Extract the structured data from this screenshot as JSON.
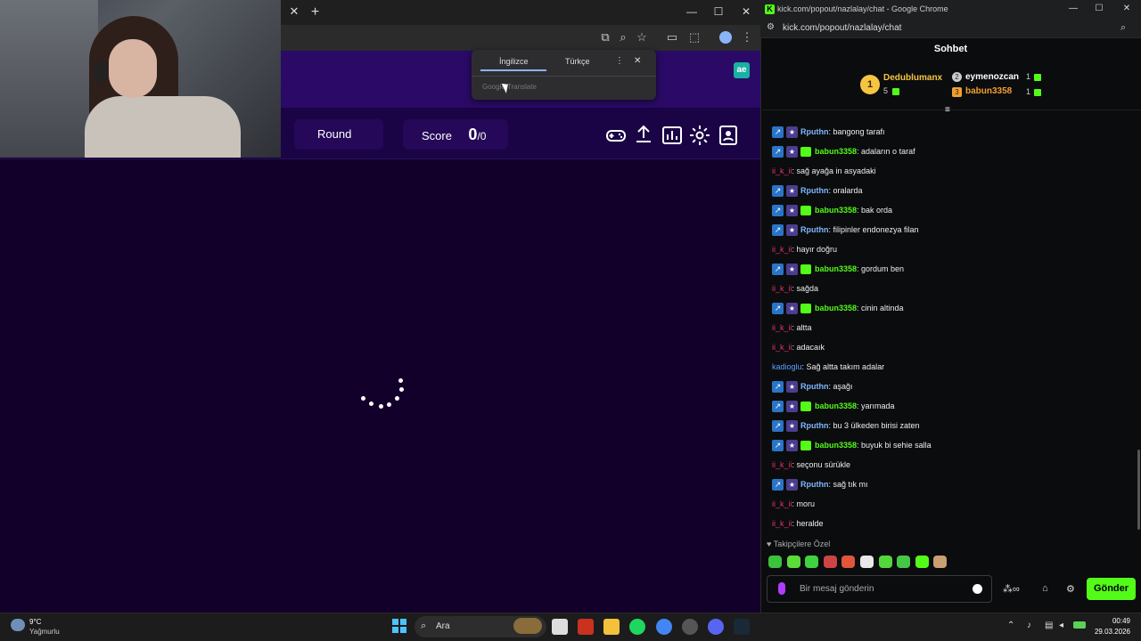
{
  "left_browser": {
    "game": {
      "round_label": "Round",
      "score_label": "Score",
      "score_value": "0",
      "score_total": "/0",
      "brand_badge": "ae"
    },
    "translate_popup": {
      "tab_source": "İngilizce",
      "tab_target": "Türkçe",
      "logo": "Google Translate"
    }
  },
  "chat_window": {
    "title_bar": "kick.com/popout/nazlalay/chat - Google Chrome",
    "url": "kick.com/popout/nazlalay/chat",
    "header": "Sohbet",
    "top_gifters": [
      {
        "name": "Dedublumanx",
        "count": "5",
        "color": "#f5c542"
      },
      {
        "name": "eymenozcan",
        "count": "1",
        "color": "#ffffff"
      },
      {
        "name": "babun3358",
        "count": "1",
        "color": "#f0a030"
      }
    ],
    "messages": [
      {
        "user": "Rputhn",
        "text": ": bangong tarafı",
        "style": "blue",
        "badges": 2
      },
      {
        "user": "babun3358",
        "text": ": adaların o taraf",
        "style": "green",
        "badges": 3
      },
      {
        "user": "ii_k_ii",
        "text": ": sağ ayağa in asyadaki",
        "style": "red",
        "badges": 0
      },
      {
        "user": "Rputhn",
        "text": ": oralarda",
        "style": "blue",
        "badges": 2
      },
      {
        "user": "babun3358",
        "text": ": bak orda",
        "style": "green",
        "badges": 3
      },
      {
        "user": "Rputhn",
        "text": ": filipinler endonezya filan",
        "style": "blue",
        "badges": 2
      },
      {
        "user": "ii_k_ii",
        "text": ": hayır doğru",
        "style": "red",
        "badges": 0
      },
      {
        "user": "babun3358",
        "text": ": gordum ben",
        "style": "green",
        "badges": 3
      },
      {
        "user": "ii_k_ii",
        "text": ": sağda",
        "style": "red",
        "badges": 0
      },
      {
        "user": "babun3358",
        "text": ": cinin altinda",
        "style": "green",
        "badges": 3
      },
      {
        "user": "ii_k_ii",
        "text": ": altta",
        "style": "red",
        "badges": 0
      },
      {
        "user": "ii_k_ii",
        "text": ": adacaık",
        "style": "red",
        "badges": 0
      },
      {
        "user": "kadioglu",
        "text": ": Sağ altta takım adalar",
        "style": "kadi",
        "badges": 0
      },
      {
        "user": "Rputhn",
        "text": ": aşağı",
        "style": "blue",
        "badges": 2
      },
      {
        "user": "babun3358",
        "text": ": yarımada",
        "style": "green",
        "badges": 3
      },
      {
        "user": "Rputhn",
        "text": ": bu 3 ülkeden birisi zaten",
        "style": "blue",
        "badges": 2
      },
      {
        "user": "babun3358",
        "text": ": buyuk bi sehie salla",
        "style": "green",
        "badges": 3
      },
      {
        "user": "ii_k_ii",
        "text": ": seçonu sürükle",
        "style": "red",
        "badges": 0
      },
      {
        "user": "Rputhn",
        "text": ": sağ tık mı",
        "style": "blue",
        "badges": 2
      },
      {
        "user": "ii_k_ii",
        "text": ": moru",
        "style": "red",
        "badges": 0
      },
      {
        "user": "ii_k_ii",
        "text": ": heralde",
        "style": "red",
        "badges": 0
      }
    ],
    "follower_only": "Takipçilere Özel",
    "input_placeholder": "Bir mesaj gönderin",
    "send_label": "Gönder"
  },
  "taskbar": {
    "weather_temp": "9°C",
    "weather_desc": "Yağmurlu",
    "search_label": "Ara",
    "time": "00:49",
    "date": "29.03.2026"
  }
}
